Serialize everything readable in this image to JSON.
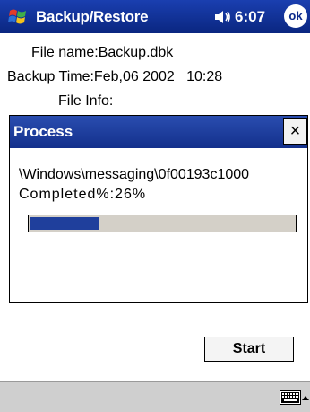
{
  "titlebar": {
    "title": "Backup/Restore",
    "time": "6:07",
    "ok_label": "ok"
  },
  "file_info": {
    "file_name": "File name:Backup.dbk",
    "backup_time": "Backup Time:Feb,06 2002   10:28",
    "info_label": "File Info:"
  },
  "dialog": {
    "title": "Process",
    "close_label": "×",
    "path": "\\Windows\\messaging\\0f00193c1000",
    "completed": "Completed%:26%",
    "progress": 0.26
  },
  "actions": {
    "start_label": "Start"
  },
  "colors": {
    "titlebar": "#0b2a8c",
    "progress_fill": "#1f3f9c",
    "menubar": "#cfcfcf"
  },
  "icons": {
    "start": "windows-flag-icon",
    "volume": "speaker-icon",
    "keyboard": "keyboard-icon",
    "input_menu": "chevron-up-icon"
  }
}
